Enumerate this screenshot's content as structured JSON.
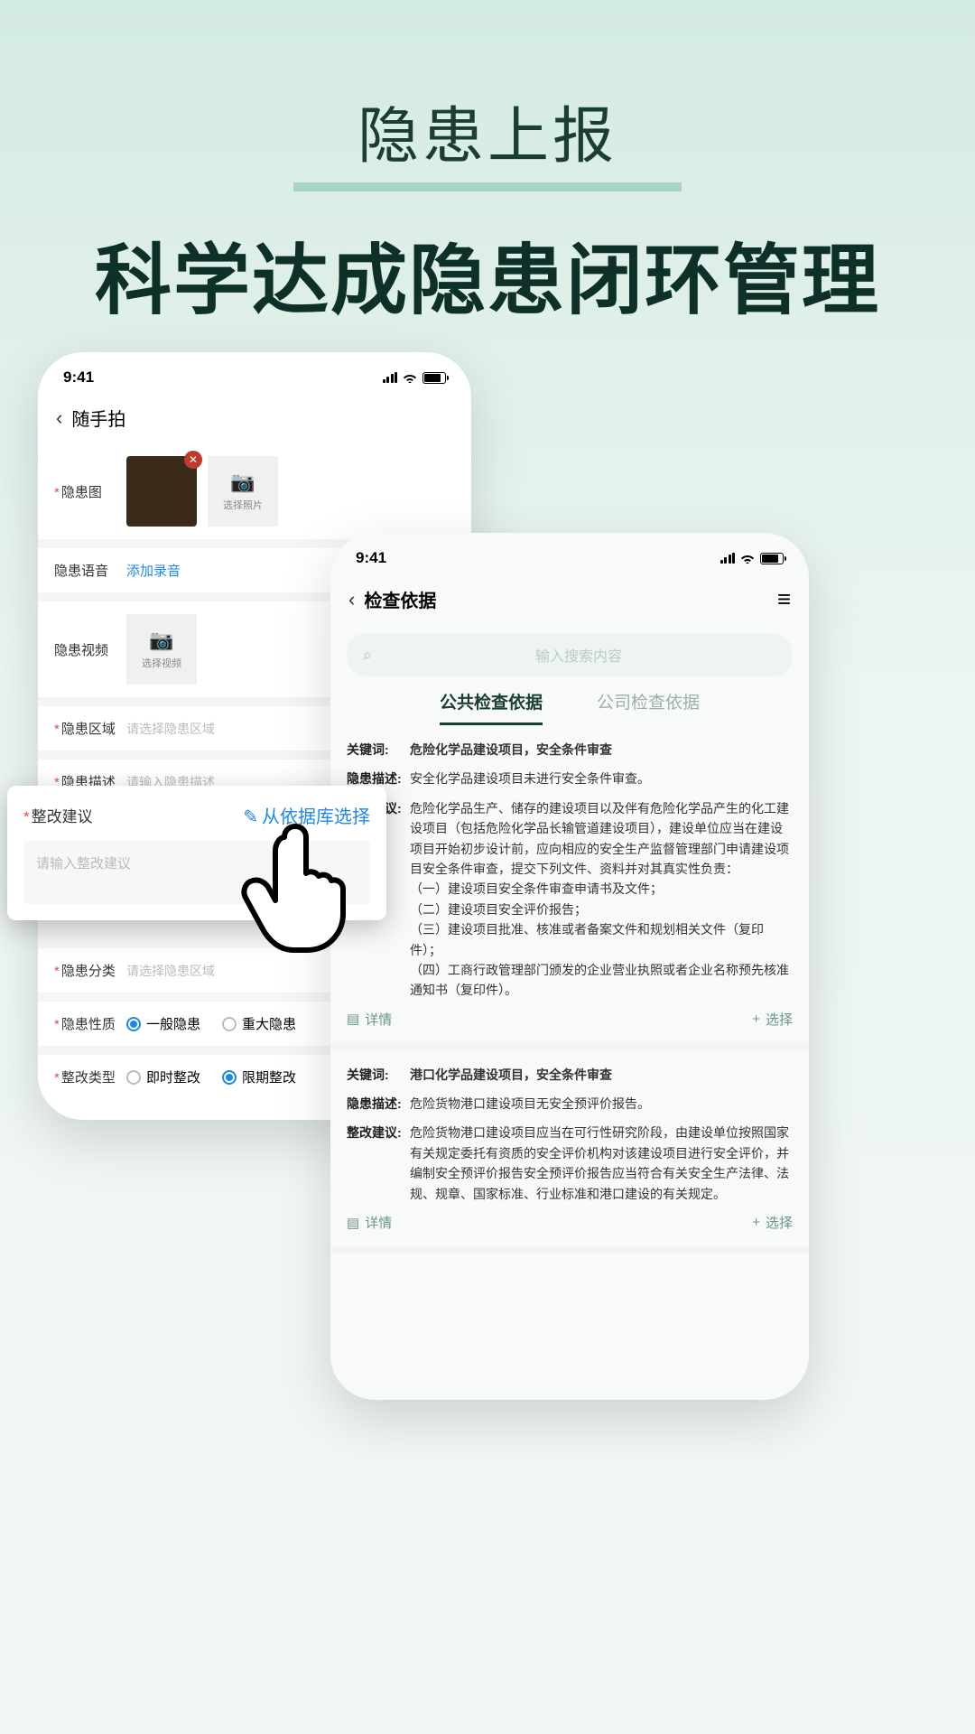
{
  "hero": {
    "title": "隐患上报",
    "subtitle": "科学达成隐患闭环管理"
  },
  "status": {
    "time": "9:41"
  },
  "phone_left": {
    "title": "随手拍",
    "labels": {
      "img": "隐患图",
      "select_photo": "选择照片",
      "voice": "隐患语音",
      "add_record": "添加录音",
      "video": "隐患视频",
      "select_video": "选择视频",
      "area": "隐患区域",
      "area_ph": "请选择隐患区域",
      "desc": "隐患描述",
      "desc_ph": "请输入隐患描述",
      "category": "隐患分类",
      "category_ph": "请选择隐患区域",
      "nature": "隐患性质",
      "rect_type": "整改类型"
    },
    "nature_opts": [
      "一般隐患",
      "重大隐患"
    ],
    "rect_opts": [
      "即时整改",
      "限期整改"
    ]
  },
  "popup": {
    "label": "整改建议",
    "link": "从依据库选择",
    "ph": "请输入整改建议"
  },
  "phone_right": {
    "title": "检查依据",
    "search_ph": "输入搜索内容",
    "tabs": [
      "公共检查依据",
      "公司检查依据"
    ],
    "item1": {
      "kw_label": "关键词:",
      "kw": "危险化学品建设项目，安全条件审查",
      "desc_label": "隐患描述:",
      "desc": "安全化学品建设项目未进行安全条件审查。",
      "sug_label": "整改建议:",
      "sug": "危险化学品生产、储存的建设项目以及伴有危险化学品产生的化工建设项目（包括危险化学品长输管道建设项目），建设单位应当在建设项目开始初步设计前，应向相应的安全生产监督管理部门申请建设项目安全条件审查，提交下列文件、资料并对其真实性负责：\n（一）建设项目安全条件审查申请书及文件；\n（二）建设项目安全评价报告；\n（三）建设项目批准、核准或者备案文件和规划相关文件（复印件）；\n（四）工商行政管理部门颁发的企业营业执照或者企业名称预先核准通知书（复印件）。"
    },
    "item2": {
      "kw_label": "关键词:",
      "kw": "港口化学品建设项目，安全条件审查",
      "desc_label": "隐患描述:",
      "desc": "危险货物港口建设项目无安全预评价报告。",
      "sug_label": "整改建议:",
      "sug": "危险货物港口建设项目应当在可行性研究阶段，由建设单位按照国家有关规定委托有资质的安全评价机构对该建设项目进行安全评价，并编制安全预评价报告安全预评价报告应当符合有关安全生产法律、法规、规章、国家标准、行业标准和港口建设的有关规定。"
    },
    "actions": {
      "detail": "详情",
      "select": "选择"
    }
  }
}
